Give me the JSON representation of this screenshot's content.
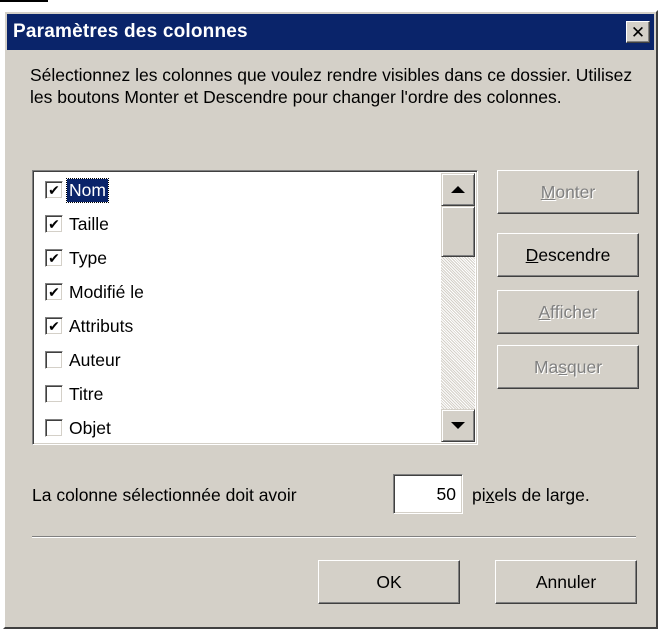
{
  "dialog": {
    "title": "Paramètres des colonnes",
    "close_label": "✕",
    "description": "Sélectionnez les colonnes que voulez rendre visibles dans ce dossier. Utilisez les boutons Monter et Descendre pour changer l'ordre des colonnes."
  },
  "columns_list": {
    "items": [
      {
        "label": "Nom",
        "checked": true,
        "selected": true
      },
      {
        "label": "Taille",
        "checked": true,
        "selected": false
      },
      {
        "label": "Type",
        "checked": true,
        "selected": false
      },
      {
        "label": "Modifié le",
        "checked": true,
        "selected": false
      },
      {
        "label": "Attributs",
        "checked": true,
        "selected": false
      },
      {
        "label": "Auteur",
        "checked": false,
        "selected": false
      },
      {
        "label": "Titre",
        "checked": false,
        "selected": false
      },
      {
        "label": "Objet",
        "checked": false,
        "selected": false
      }
    ]
  },
  "buttons": {
    "move_up": {
      "pre": "",
      "mnemonic": "M",
      "post": "onter",
      "enabled": false
    },
    "move_down": {
      "pre": "",
      "mnemonic": "D",
      "post": "escendre",
      "enabled": true
    },
    "show": {
      "pre": "",
      "mnemonic": "A",
      "post": "fficher",
      "enabled": false
    },
    "hide": {
      "pre": "Ma",
      "mnemonic": "s",
      "post": "quer",
      "enabled": false
    },
    "ok": "OK",
    "cancel": "Annuler"
  },
  "width_setting": {
    "label": "La colonne sélectionnée doit avoir",
    "value": "50",
    "suffix_pre": "pi",
    "suffix_mnemonic": "x",
    "suffix_post": "els de large."
  },
  "colors": {
    "title_bar": "#0a246a",
    "dialog_bg": "#d4d0c8",
    "disabled_text": "#808080"
  }
}
